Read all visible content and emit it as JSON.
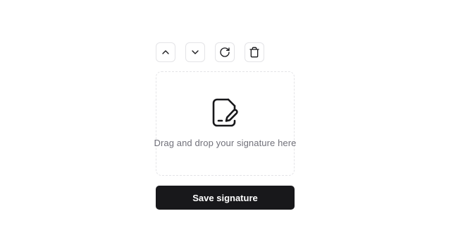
{
  "toolbar": {
    "buttons": [
      {
        "icon": "chevron-up-icon"
      },
      {
        "icon": "chevron-down-icon"
      },
      {
        "icon": "rotate-cw-icon"
      },
      {
        "icon": "trash-icon"
      }
    ]
  },
  "dropzone": {
    "icon": "file-signature-icon",
    "text": "Drag and drop your signature here"
  },
  "save_button": {
    "label": "Save signature"
  },
  "colors": {
    "primary": "#18181b",
    "muted_text": "#71717a",
    "border": "#e4e4e7"
  }
}
